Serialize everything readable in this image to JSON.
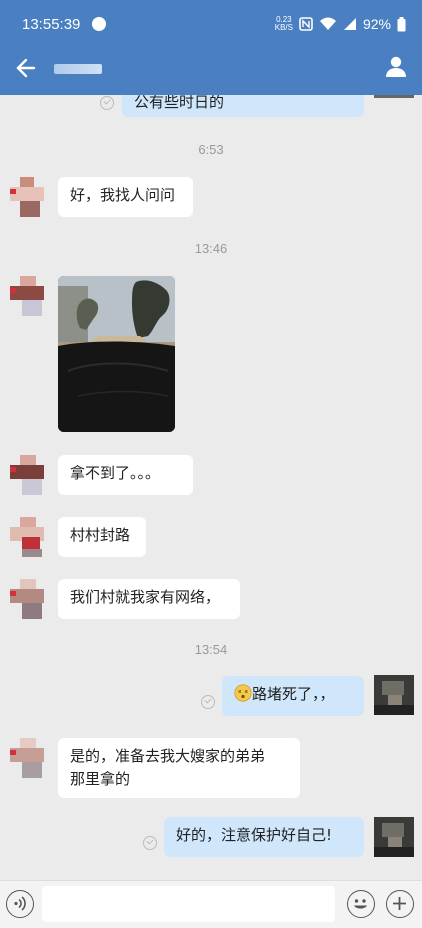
{
  "status_bar": {
    "time": "13:55:39",
    "net_speed_value": "0.23",
    "net_speed_unit": "KB/S",
    "battery": "92%"
  },
  "messages": {
    "m0_partial": "公有些时日的",
    "ts1": "6:53",
    "m1": "好，我找人问问",
    "ts2": "13:46",
    "m3": "拿不到了。。。",
    "m4": "村村封路",
    "m5": "我们村就我家有网络，",
    "ts3": "13:54",
    "m6": "路堵死了，，",
    "m7_line1": "是的，准备去我大嫂家的弟弟",
    "m7_line2": "那里拿的",
    "m8": "好的，注意保护好自己!"
  },
  "icons": [
    "back-arrow-icon",
    "profile-icon",
    "voice-icon",
    "emoji-icon",
    "plus-icon",
    "read-check-icon",
    "dizzy-face-emoji"
  ],
  "colors": {
    "header": "#4a7fc1",
    "chat_bg": "#ebebeb",
    "incoming": "#ffffff",
    "outgoing": "#cfe6fb"
  }
}
